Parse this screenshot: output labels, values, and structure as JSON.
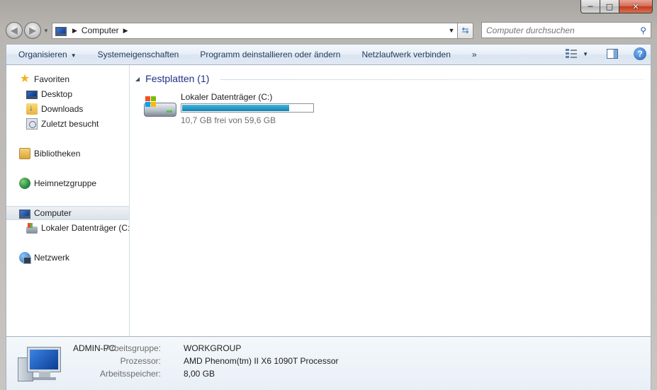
{
  "window": {
    "caption_buttons": {
      "minimize": "─",
      "maximize": "□",
      "close": "✕"
    }
  },
  "navigation": {
    "back_glyph": "◀",
    "forward_glyph": "▶",
    "address": {
      "segment": "Computer",
      "chevron": "▶"
    },
    "search_placeholder": "Computer durchsuchen"
  },
  "commandbar": {
    "items": [
      "Organisieren",
      "Systemeigenschaften",
      "Programm deinstallieren oder ändern",
      "Netzlaufwerk verbinden"
    ],
    "overflow": "»"
  },
  "sidebar": {
    "favorites": {
      "label": "Favoriten",
      "icon": "star-icon",
      "children": [
        {
          "label": "Desktop",
          "icon": "desktop-icon"
        },
        {
          "label": "Downloads",
          "icon": "downloads-folder-icon"
        },
        {
          "label": "Zuletzt besucht",
          "icon": "recent-places-icon"
        }
      ]
    },
    "libraries": {
      "label": "Bibliotheken",
      "icon": "libraries-icon"
    },
    "homegroup": {
      "label": "Heimnetzgruppe",
      "icon": "homegroup-icon"
    },
    "computer": {
      "label": "Computer",
      "icon": "computer-icon",
      "selected": true,
      "children": [
        {
          "label": "Lokaler Datenträger (C:)",
          "icon": "local-disk-icon"
        }
      ]
    },
    "network": {
      "label": "Netzwerk",
      "icon": "network-icon"
    }
  },
  "main": {
    "group": {
      "title": "Festplatten (1)"
    },
    "drives": [
      {
        "name": "Lokaler Datenträger (C:)",
        "free_text": "10,7 GB frei von 59,6 GB",
        "used_fraction": 0.82,
        "icon": "hard-drive-icon"
      }
    ]
  },
  "details": {
    "name": "ADMIN-PC",
    "rows": [
      {
        "label": "Arbeitsgruppe:",
        "value": "WORKGROUP"
      },
      {
        "label": "Prozessor:",
        "value": "AMD Phenom(tm) II X6 1090T Processor"
      },
      {
        "label": "Arbeitsspeicher:",
        "value": "8,00 GB"
      }
    ]
  },
  "colors": {
    "accent_blue": "#1e3287",
    "progress_fill": "#26a0d0",
    "command_text": "#1e395b"
  }
}
